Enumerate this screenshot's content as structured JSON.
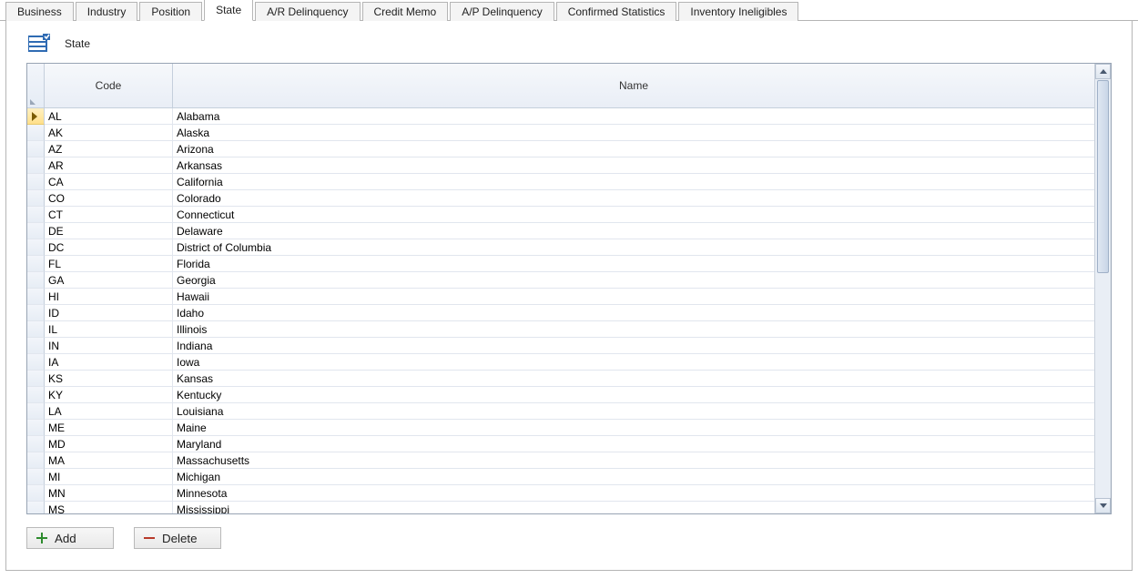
{
  "tabs": [
    {
      "label": "Business"
    },
    {
      "label": "Industry"
    },
    {
      "label": "Position"
    },
    {
      "label": "State",
      "active": true
    },
    {
      "label": "A/R Delinquency"
    },
    {
      "label": "Credit Memo"
    },
    {
      "label": "A/P Delinquency"
    },
    {
      "label": "Confirmed Statistics"
    },
    {
      "label": "Inventory Ineligibles"
    }
  ],
  "section_title": "State",
  "grid": {
    "columns": {
      "code": "Code",
      "name": "Name"
    },
    "rows": [
      {
        "code": "AL",
        "name": "Alabama",
        "selected": true
      },
      {
        "code": "AK",
        "name": "Alaska"
      },
      {
        "code": "AZ",
        "name": "Arizona"
      },
      {
        "code": "AR",
        "name": "Arkansas"
      },
      {
        "code": "CA",
        "name": "California"
      },
      {
        "code": "CO",
        "name": "Colorado"
      },
      {
        "code": "CT",
        "name": "Connecticut"
      },
      {
        "code": "DE",
        "name": "Delaware"
      },
      {
        "code": "DC",
        "name": "District of Columbia"
      },
      {
        "code": "FL",
        "name": "Florida"
      },
      {
        "code": "GA",
        "name": "Georgia"
      },
      {
        "code": "HI",
        "name": "Hawaii"
      },
      {
        "code": "ID",
        "name": "Idaho"
      },
      {
        "code": "IL",
        "name": "Illinois"
      },
      {
        "code": "IN",
        "name": "Indiana"
      },
      {
        "code": "IA",
        "name": "Iowa"
      },
      {
        "code": "KS",
        "name": "Kansas"
      },
      {
        "code": "KY",
        "name": "Kentucky"
      },
      {
        "code": "LA",
        "name": "Louisiana"
      },
      {
        "code": "ME",
        "name": "Maine"
      },
      {
        "code": "MD",
        "name": "Maryland"
      },
      {
        "code": "MA",
        "name": "Massachusetts"
      },
      {
        "code": "MI",
        "name": "Michigan"
      },
      {
        "code": "MN",
        "name": "Minnesota"
      },
      {
        "code": "MS",
        "name": "Mississippi"
      }
    ]
  },
  "buttons": {
    "add": "Add",
    "delete": "Delete"
  }
}
